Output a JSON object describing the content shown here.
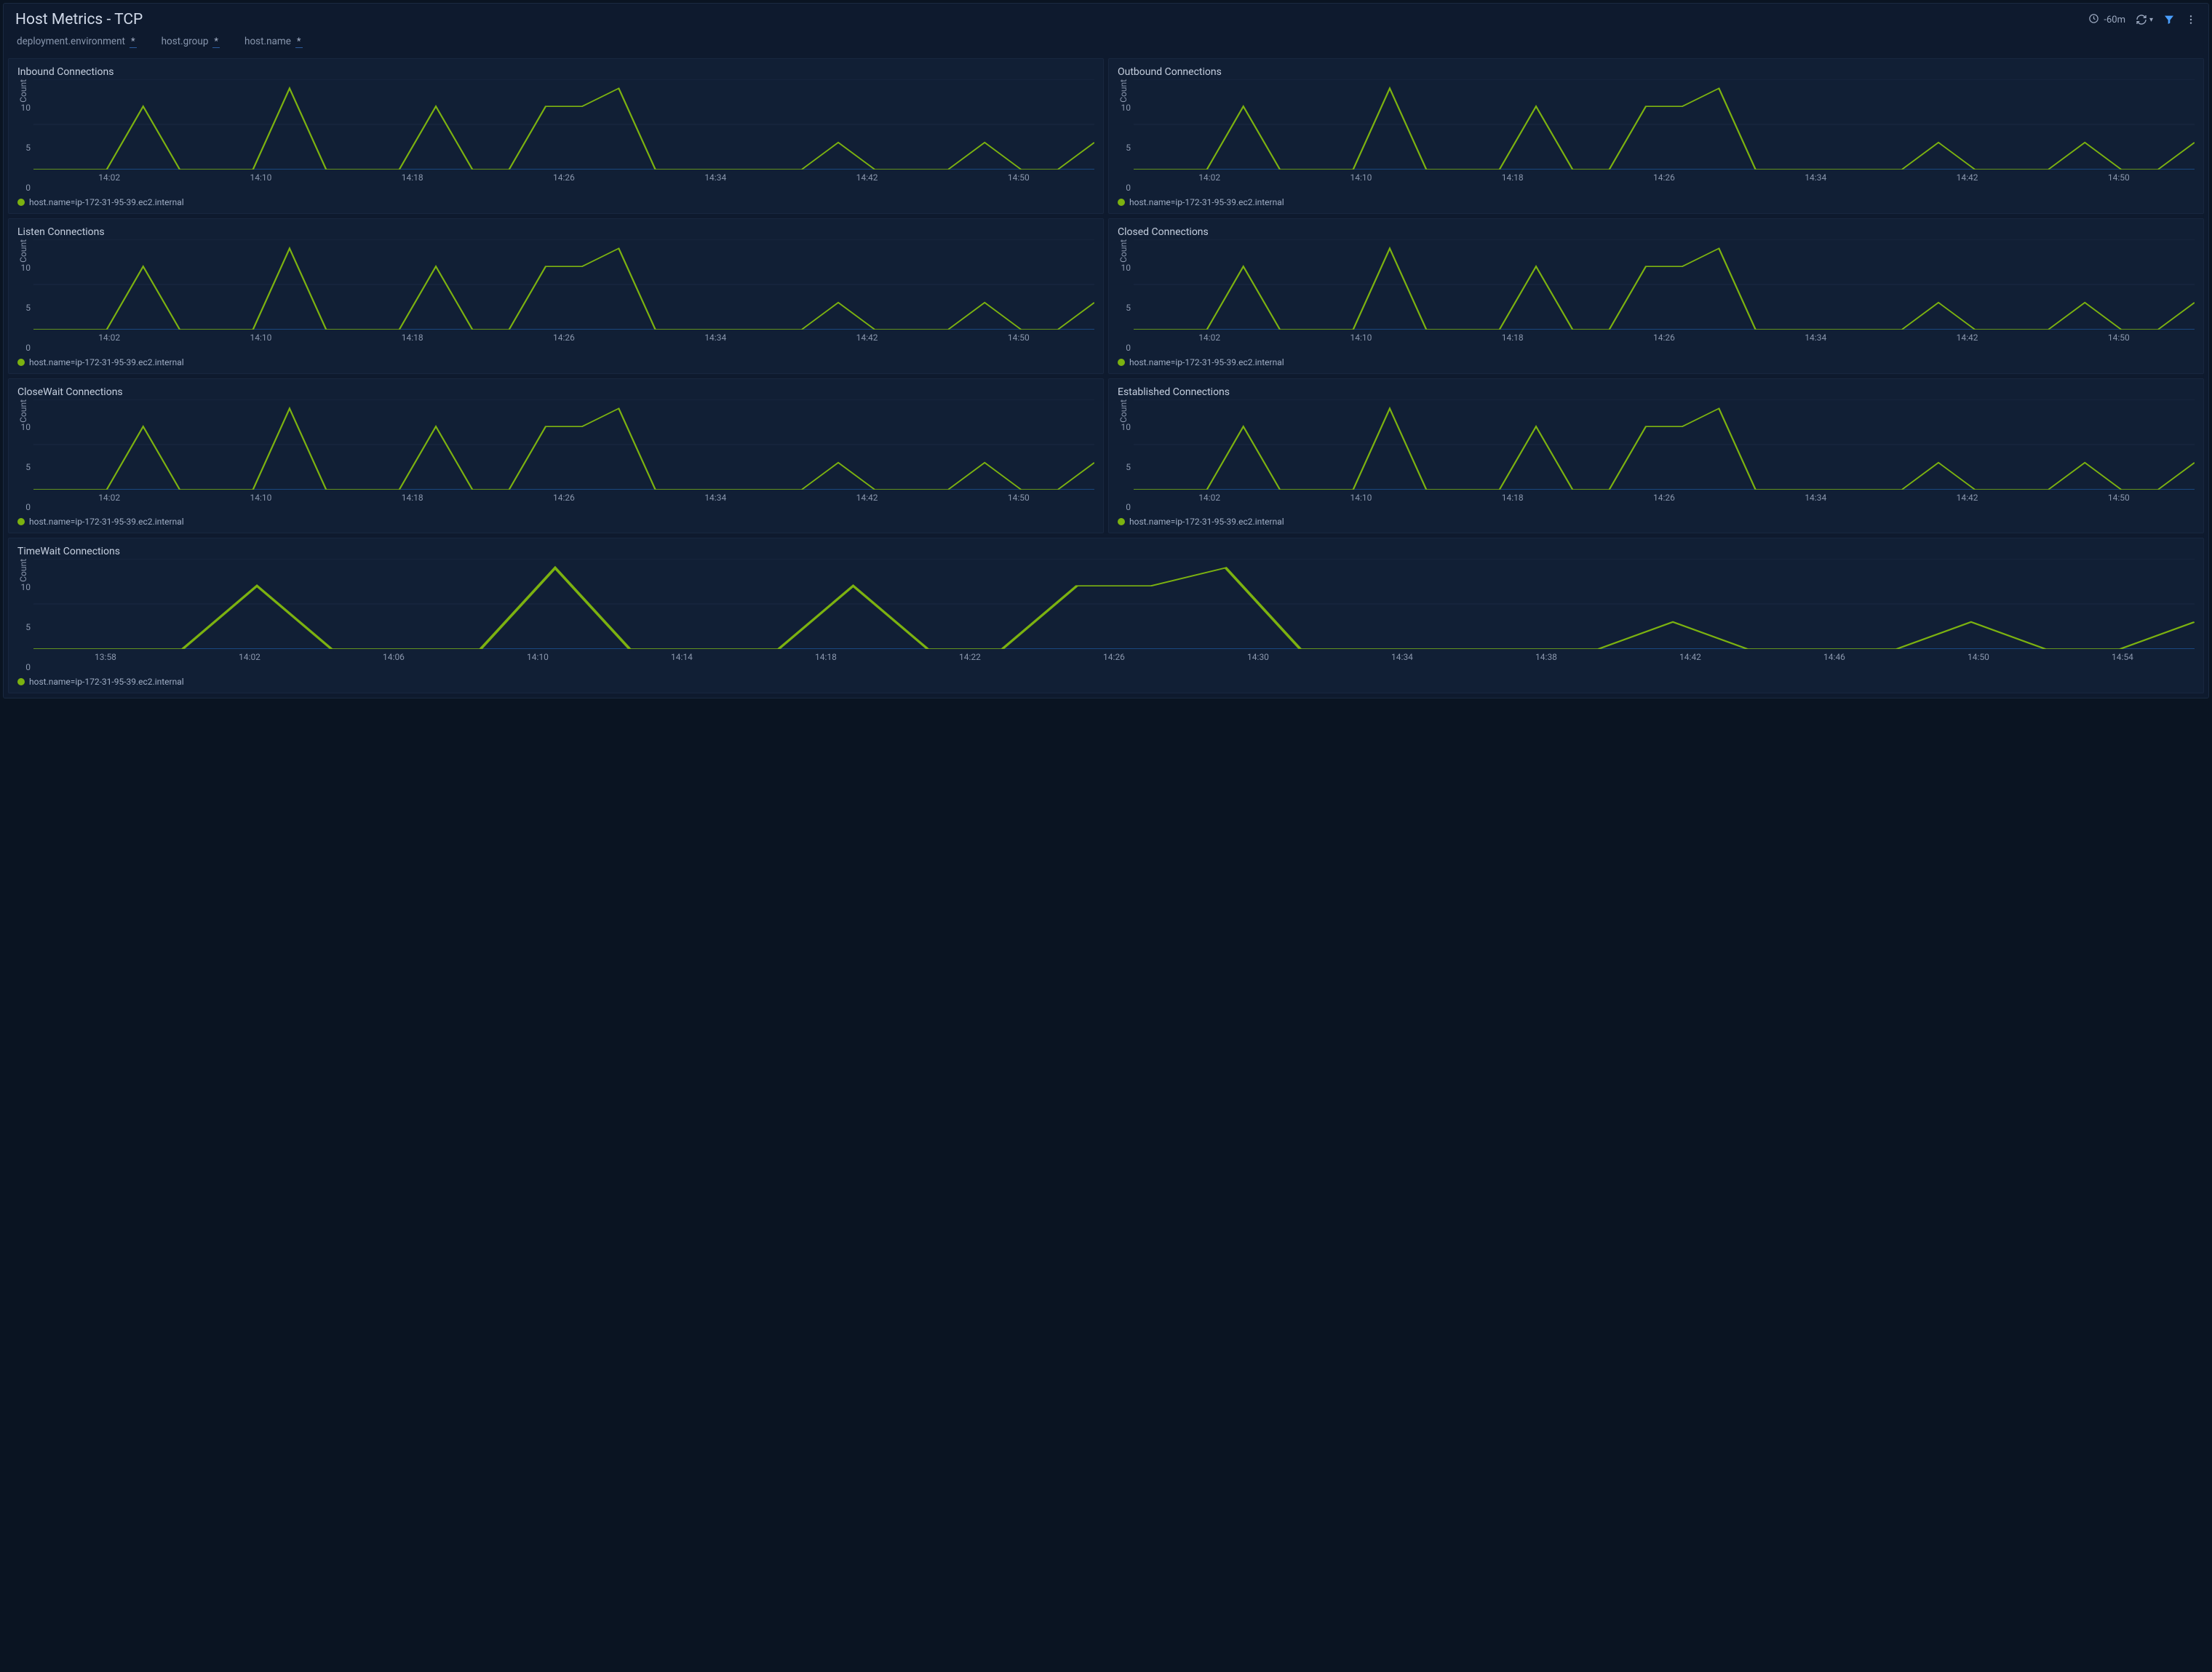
{
  "header": {
    "title": "Host Metrics - TCP",
    "timerange": "-60m"
  },
  "filters": [
    {
      "label": "deployment.environment",
      "value": "*"
    },
    {
      "label": "host.group",
      "value": "*"
    },
    {
      "label": "host.name",
      "value": "*"
    }
  ],
  "legend_text": "host.name=ip-172-31-95-39.ec2.internal",
  "y_label": "Count",
  "y_ticks": [
    "10",
    "5",
    "0"
  ],
  "x_ticks_small": [
    "14:02",
    "14:10",
    "14:18",
    "14:26",
    "14:34",
    "14:42",
    "14:50"
  ],
  "x_ticks_large": [
    "13:58",
    "14:02",
    "14:06",
    "14:10",
    "14:14",
    "14:18",
    "14:22",
    "14:26",
    "14:30",
    "14:34",
    "14:38",
    "14:42",
    "14:46",
    "14:50",
    "14:54"
  ],
  "panels": [
    {
      "title": "Inbound Connections"
    },
    {
      "title": "Outbound Connections"
    },
    {
      "title": "Listen Connections"
    },
    {
      "title": "Closed Connections"
    },
    {
      "title": "CloseWait Connections"
    },
    {
      "title": "Established Connections"
    },
    {
      "title": "TimeWait Connections"
    }
  ],
  "chart_data": {
    "type": "line",
    "ylabel": "Count",
    "ylim": [
      0,
      10
    ],
    "x": [
      "13:56",
      "13:58",
      "14:00",
      "14:02",
      "14:04",
      "14:06",
      "14:08",
      "14:10",
      "14:12",
      "14:14",
      "14:16",
      "14:18",
      "14:20",
      "14:22",
      "14:24",
      "14:26",
      "14:28",
      "14:30",
      "14:32",
      "14:34",
      "14:36",
      "14:38",
      "14:40",
      "14:42",
      "14:44",
      "14:46",
      "14:48",
      "14:50",
      "14:52",
      "14:54"
    ],
    "series": [
      {
        "name": "host.name=ip-172-31-95-39.ec2.internal",
        "values": [
          0,
          0,
          0,
          7,
          0,
          0,
          0,
          9,
          0,
          0,
          0,
          7,
          0,
          0,
          7,
          7,
          9,
          0,
          0,
          0,
          0,
          0,
          3,
          0,
          0,
          0,
          3,
          0,
          0,
          3
        ]
      }
    ],
    "note": "All seven panels (Inbound, Outbound, Listen, Closed, CloseWait, Established, TimeWait Connections) render the identical series above."
  }
}
